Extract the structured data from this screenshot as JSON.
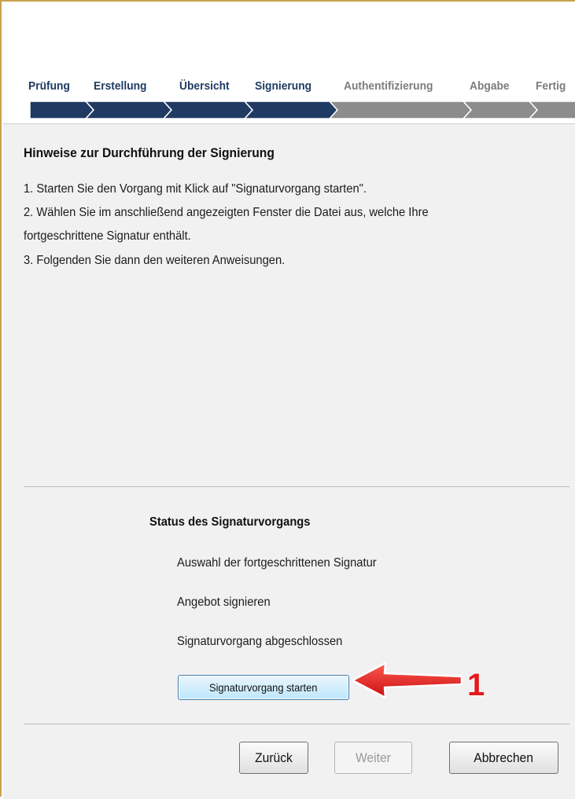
{
  "steps": [
    {
      "label": "Prüfung",
      "state": "done"
    },
    {
      "label": "Erstellung",
      "state": "done"
    },
    {
      "label": "Übersicht",
      "state": "done"
    },
    {
      "label": "Signierung",
      "state": "done"
    },
    {
      "label": "Authentifizierung",
      "state": "todo"
    },
    {
      "label": "Abgabe",
      "state": "todo"
    },
    {
      "label": "Fertig",
      "state": "todo"
    }
  ],
  "colors": {
    "done": "#1f3b63",
    "todo": "#8c8c8c",
    "annotation_arrow": "#e3191b",
    "panel_bg": "#f1f1f1"
  },
  "instructions": {
    "title": "Hinweise zur Durchführung der Signierung",
    "lines": [
      "1. Starten Sie den Vorgang mit Klick auf \"Signaturvorgang starten\".",
      "2. Wählen Sie im anschließend angezeigten Fenster die Datei aus, welche Ihre",
      "fortgeschrittene Signatur enthält.",
      "3. Folgenden Sie dann den weiteren Anweisungen."
    ]
  },
  "status": {
    "title": "Status des Signaturvorgangs",
    "items": [
      "Auswahl der fortgeschrittenen Signatur",
      "Angebot signieren",
      "Signaturvorgang abgeschlossen"
    ],
    "start_button": "Signaturvorgang starten"
  },
  "annotation": {
    "number": "1",
    "icon": "red-arrow-icon"
  },
  "footer": {
    "back": "Zurück",
    "next": "Weiter",
    "cancel": "Abbrechen"
  }
}
